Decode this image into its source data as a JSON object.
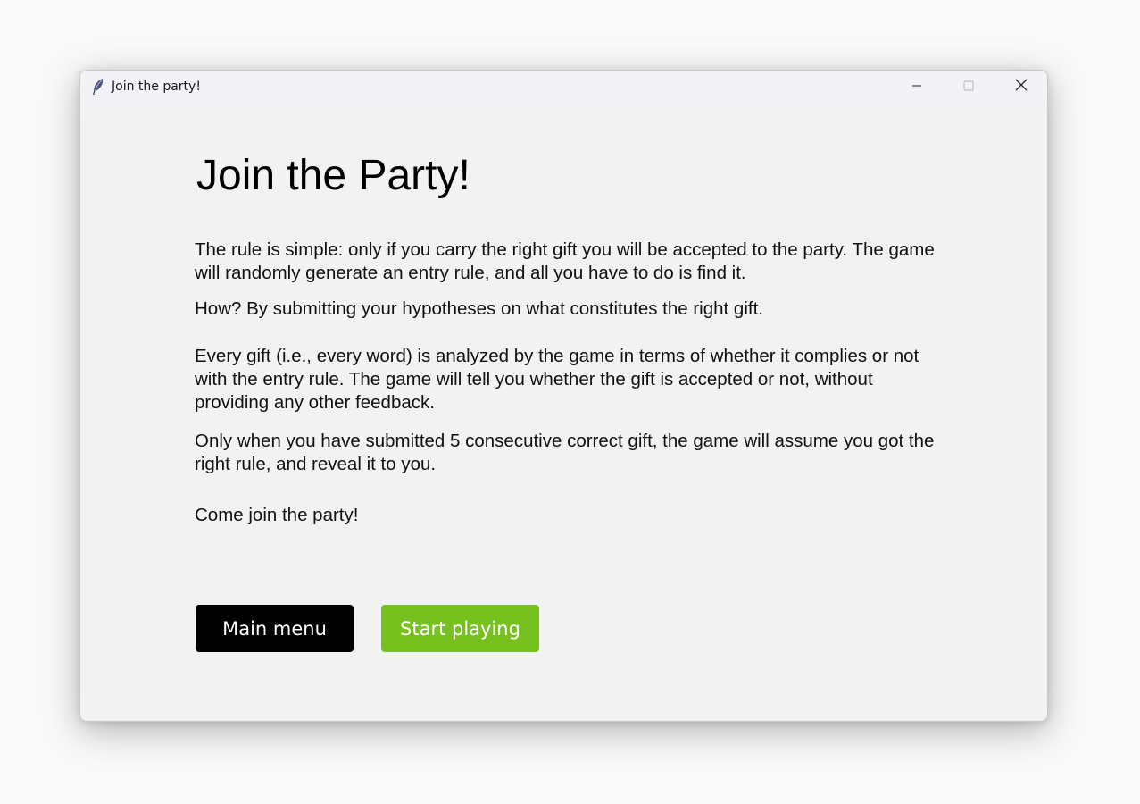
{
  "window": {
    "title": "Join the party!",
    "app_icon": "feather-icon",
    "controls": [
      "minimize-icon",
      "maximize-icon",
      "close-icon"
    ]
  },
  "content": {
    "heading": "Join the Party!",
    "paragraphs": [
      "The rule is simple: only if you carry the right gift you will be accepted to the party. The game will randomly generate an entry rule, and all you have to do is find it.",
      "How? By submitting your hypotheses on what constitutes the right gift.",
      "Every gift (i.e., every word) is analyzed by the game in terms of whether it complies or not with the entry rule. The game will tell you whether the gift is accepted or not, without providing any other feedback.",
      "Only when you have submitted 5 consecutive correct gift, the game will assume you got the right rule, and reveal it to you.",
      "Come join the party!"
    ]
  },
  "buttons": {
    "main_menu": "Main menu",
    "start_playing": "Start playing"
  },
  "colors": {
    "main_menu_bg": "#000000",
    "start_playing_bg": "#76c11d",
    "window_bg": "#f2f2f2"
  }
}
